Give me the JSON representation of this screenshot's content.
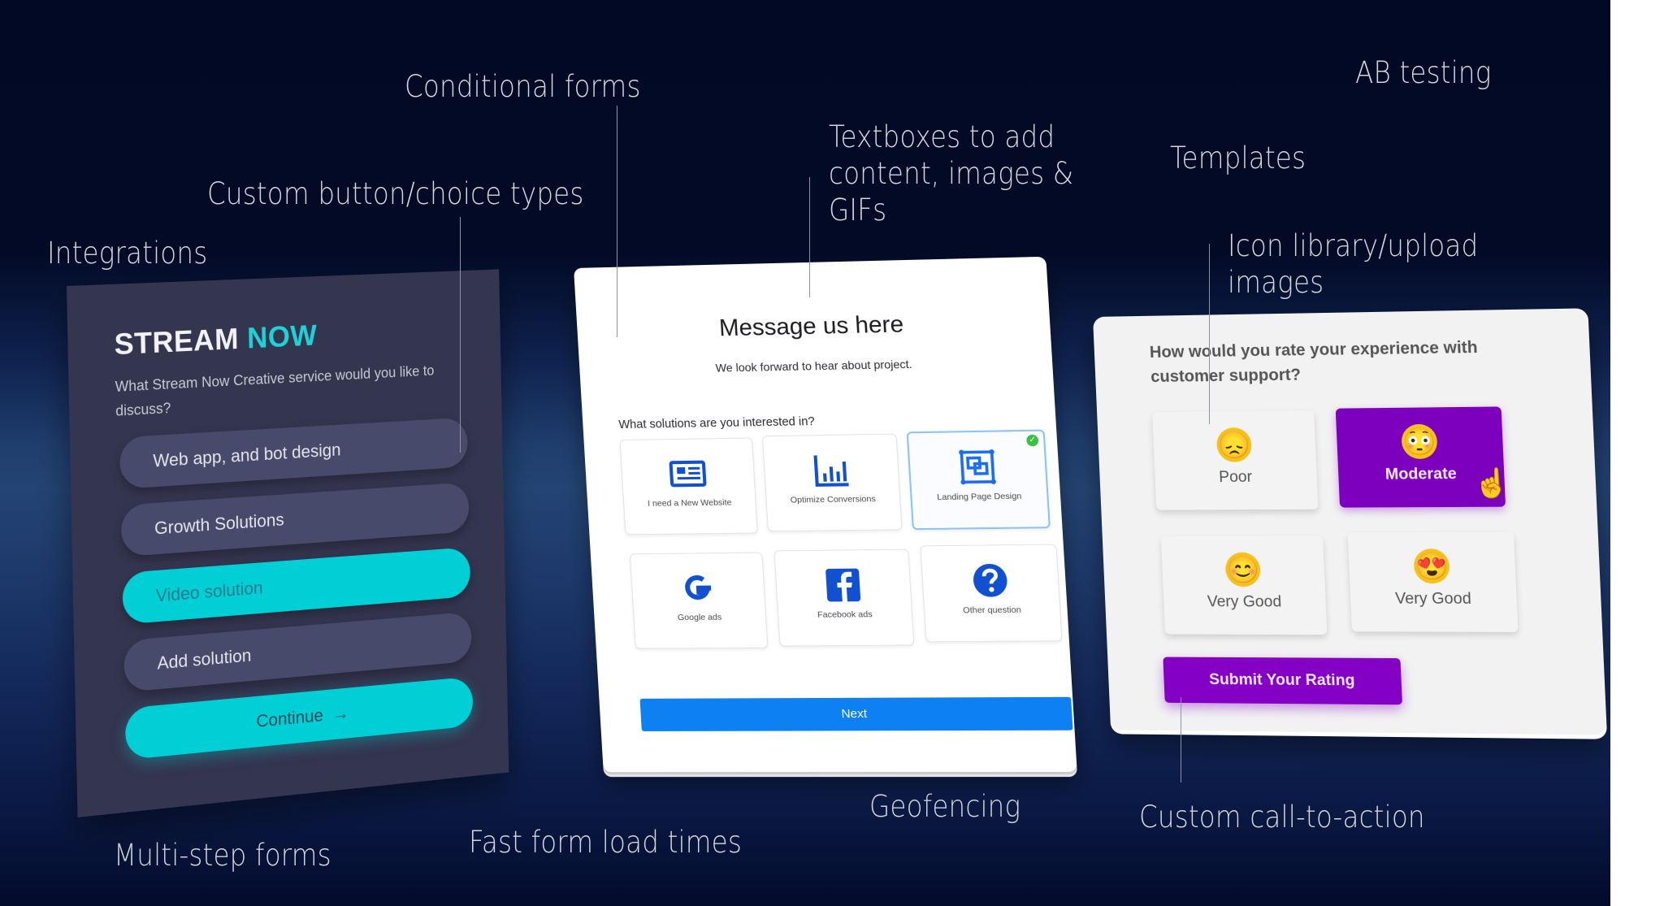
{
  "annotations": {
    "conditional_forms": "Conditional forms",
    "custom_button_types": "Custom button/choice types",
    "integrations": "Integrations",
    "textboxes_line1": "Textboxes to add",
    "textboxes_line2": "content, images &",
    "textboxes_line3": "GIFs",
    "templates": "Templates",
    "ab_testing": "AB testing",
    "icon_library_line1": "Icon library/upload",
    "icon_library_line2": "images",
    "multi_step_forms": "Multi-step forms",
    "fast_form_load": "Fast form load times",
    "geofencing": "Geofencing",
    "custom_cta": "Custom call-to-action"
  },
  "left_form": {
    "brand_primary": "STREAM",
    "brand_accent": "NOW",
    "question": "What Stream Now Creative service would you like to discuss?",
    "options": [
      {
        "label": "Web app, and bot design",
        "selected": false
      },
      {
        "label": "Growth Solutions",
        "selected": false
      },
      {
        "label": "Video solution",
        "selected": true
      },
      {
        "label": "Add solution",
        "selected": false
      }
    ],
    "continue_label": "Continue",
    "continue_icon": "arrow-right-icon",
    "accent_color": "#00d0d6"
  },
  "middle_form": {
    "title": "Message us here",
    "subtitle": "We look forward to hear about project.",
    "question": "What solutions are you interested in?",
    "options": [
      {
        "label": "I need a New Website",
        "icon": "newspaper-icon",
        "selected": false
      },
      {
        "label": "Optimize Conversions",
        "icon": "bar-chart-icon",
        "selected": false
      },
      {
        "label": "Landing Page Design",
        "icon": "layers-frame-icon",
        "selected": true
      },
      {
        "label": "Google ads",
        "icon": "google-icon",
        "selected": false
      },
      {
        "label": "Facebook ads",
        "icon": "facebook-icon",
        "selected": false
      },
      {
        "label": "Other question",
        "icon": "question-circle-icon",
        "selected": false
      }
    ],
    "next_label": "Next",
    "accent_color": "#0d80f2"
  },
  "right_form": {
    "question": "How would you rate your experience with customer support?",
    "options": [
      {
        "label": "Poor",
        "emoji": "😞",
        "selected": false
      },
      {
        "label": "Moderate",
        "emoji": "😳",
        "selected": true
      },
      {
        "label": "Very Good",
        "emoji": "😊",
        "selected": false
      },
      {
        "label": "Very Good",
        "emoji": "😍",
        "selected": false
      }
    ],
    "submit_label": "Submit Your Rating",
    "accent_color": "#8400c4"
  }
}
